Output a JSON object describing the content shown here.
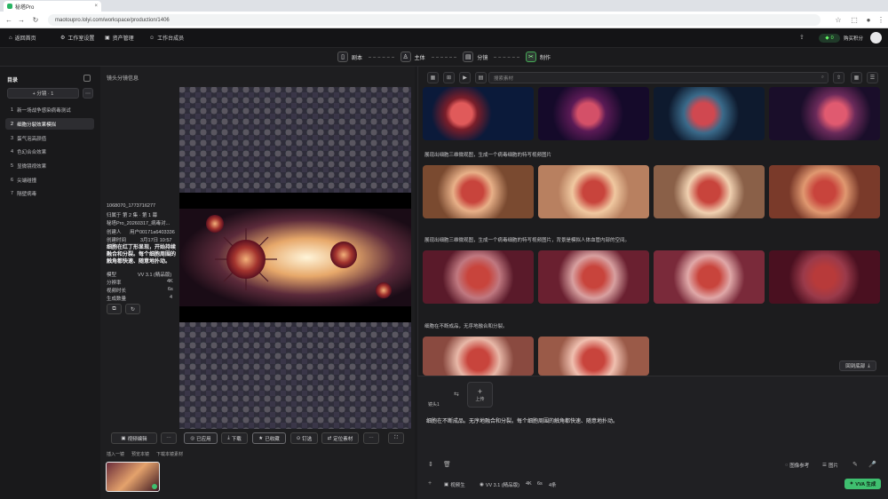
{
  "browser": {
    "tab_title": "秘塔Pro",
    "url": "maotoupro.lolyi.com/workspace/production/1406"
  },
  "header": {
    "home_label": "返回首页",
    "nav": [
      "工作室设置",
      "资产管理",
      "工作台成员"
    ],
    "credits": "0",
    "user_label": "购买积分"
  },
  "steps": [
    {
      "label": "剧本",
      "icon": "book-icon"
    },
    {
      "label": "主体",
      "icon": "person-icon"
    },
    {
      "label": "分镜",
      "icon": "clapper-icon"
    },
    {
      "label": "制作",
      "icon": "scissors-icon",
      "active": true
    }
  ],
  "sidebar": {
    "title": "目录",
    "add_label": "+ 分镜 · 1",
    "items": [
      {
        "num": "1",
        "label": "新一场战争感染病毒测试"
      },
      {
        "num": "2",
        "label": "细胞分裂效果模拟",
        "active": true
      },
      {
        "num": "3",
        "label": "蛋气泡高颜值"
      },
      {
        "num": "4",
        "label": "色幻合合效果"
      },
      {
        "num": "5",
        "label": "显微镜视效果"
      },
      {
        "num": "6",
        "label": "尖端碰撞"
      },
      {
        "num": "7",
        "label": "隔壁病毒"
      }
    ]
  },
  "middle": {
    "title": "镜头分镜信息",
    "id": "1068070_1773716277",
    "scene": "归属于 第 2 集 · 第 1 幕",
    "name": "秘塔Pro_20260317_病毒对...",
    "creator_label": "创建人",
    "creator": "用户00171a6403336",
    "created_label": "创建时间",
    "created": "3月17日 10:57",
    "description": "细胞在红丁形显现，开始持续融合和分裂。每个细胞周围的触角都快速、随意地扑动。",
    "props": [
      {
        "label": "模型",
        "value": "VV 3.1 (精品版)"
      },
      {
        "label": "分辨率",
        "value": "4K"
      },
      {
        "label": "视频时长",
        "value": "6s"
      },
      {
        "label": "生成数量",
        "value": "4"
      }
    ],
    "toolbar": [
      "视频编辑",
      "已应用",
      "下载",
      "已收藏",
      "钉选",
      "定位素材"
    ],
    "actions": [
      "插入一镜",
      "预览本镜",
      "下载本镜素材"
    ]
  },
  "right": {
    "search_placeholder": "搜索素材",
    "prompts": [
      "展现出细胞三维微观图，生成一个病毒细胞的特写视频图片",
      "展现出细胞三维微观图，生成一个病毒细胞的特写视频图片，背景是模拟人体血管内部的空间。",
      "细胞在不断成品，无序地融合和分裂。"
    ],
    "back_to_top": "回到底部",
    "composer_prompt": "细胞在不断成品。无序地融合和分裂。每个细胞周围的触角都快速、随意地扑动。",
    "upload_label": "上传",
    "tab_label": "镜头1",
    "bottom_left": [
      "视频生",
      "VV 3.1 (精品版)",
      "4K",
      "6s",
      "4条"
    ],
    "bottom_right": [
      "图像参考",
      "图片",
      "VVA 生成"
    ]
  },
  "colors": {
    "accent_green": "#3fbf6f",
    "bg": "#1b1b1d"
  }
}
